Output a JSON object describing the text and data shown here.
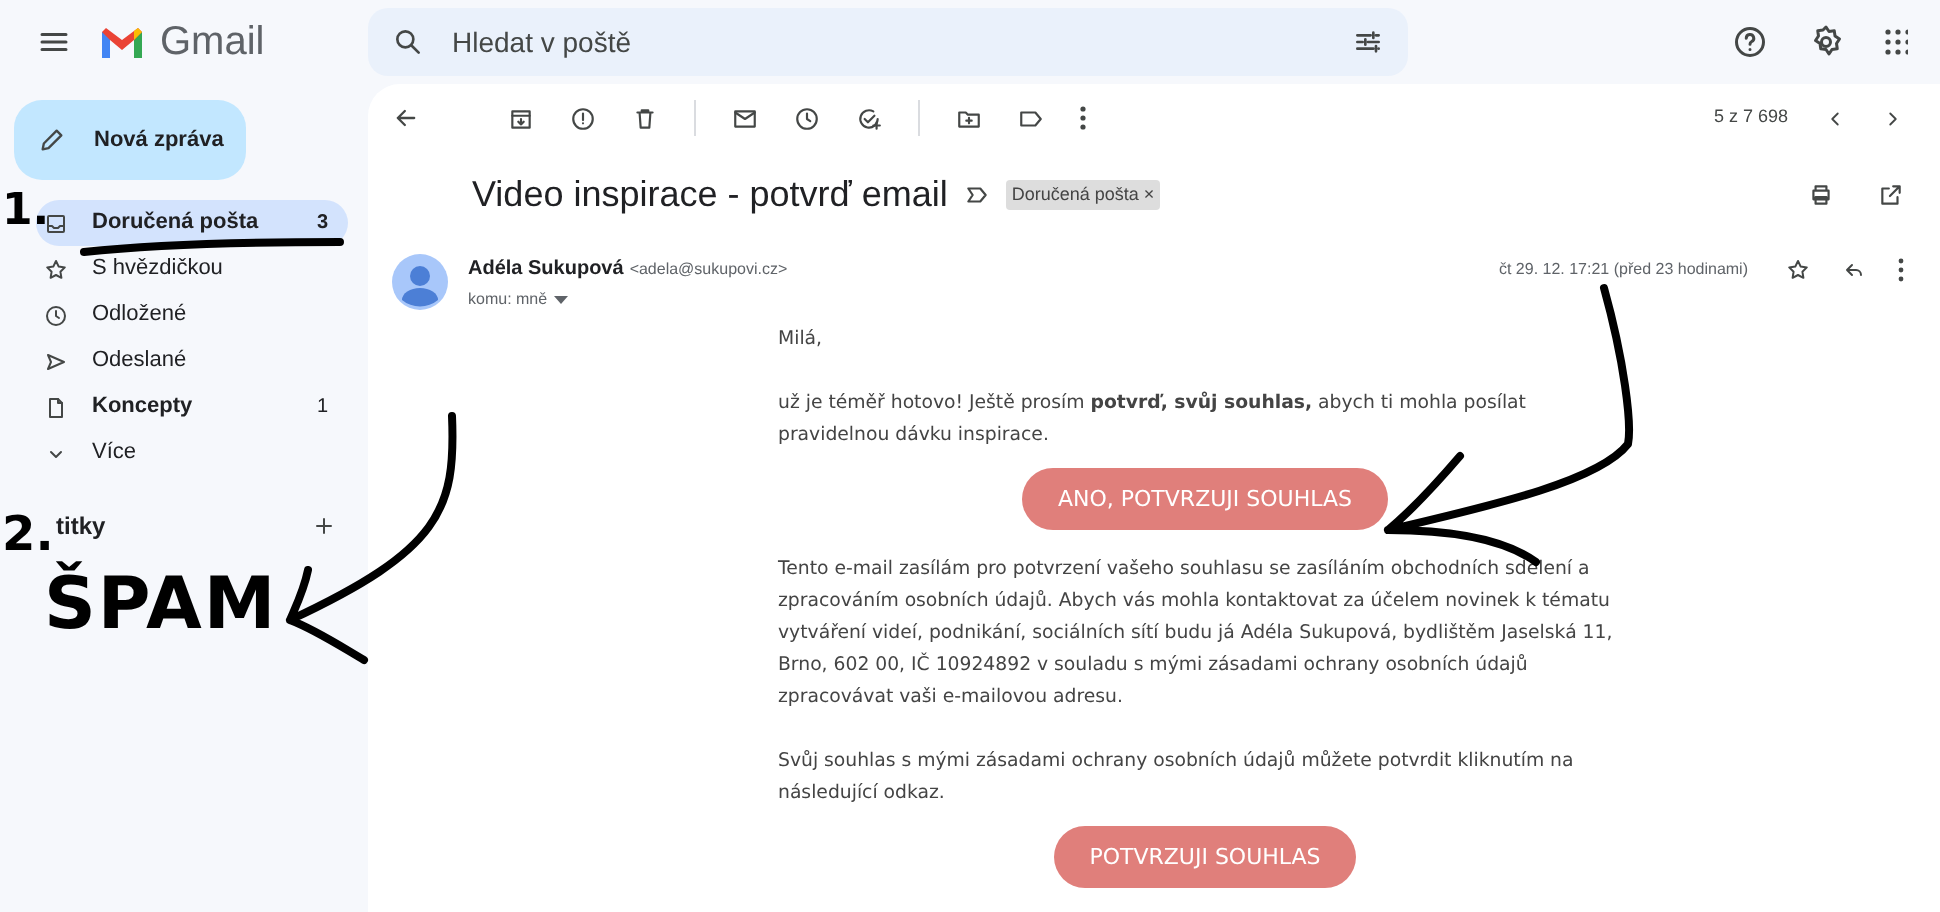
{
  "app": {
    "name": "Gmail"
  },
  "search": {
    "placeholder": "Hledat v poště"
  },
  "compose": {
    "label": "Nová zpráva"
  },
  "sidebar": {
    "items": [
      {
        "label": "Doručená pošta",
        "count": "3",
        "selected": true,
        "bold": true
      },
      {
        "label": "S hvězdičkou",
        "selected": false,
        "bold": false
      },
      {
        "label": "Odložené",
        "selected": false,
        "bold": false
      },
      {
        "label": "Odeslané",
        "selected": false,
        "bold": false
      },
      {
        "label": "Koncepty",
        "count": "1",
        "selected": false,
        "bold": true
      },
      {
        "label": "Více",
        "selected": false,
        "bold": false
      }
    ],
    "labels_heading": "titky"
  },
  "toolbar": {
    "pager": "5 z 7 698"
  },
  "message": {
    "subject": "Video inspirace - potvrď email",
    "tag": "Doručená pošta",
    "tag_close": "×",
    "sender_name": "Adéla Sukupová",
    "sender_email": "<adela@sukupovi.cz>",
    "recipient": "komu: mně",
    "date": "čt 29. 12. 17:21 (před 23 hodinami)",
    "body": [
      {
        "kind": "text",
        "text": "Milá,"
      },
      {
        "kind": "text",
        "text": "už je téměř hotovo! Ještě prosím **potvrď, svůj souhlas,** abych ti mohla posílat pravidelnou dávku inspirace."
      },
      {
        "kind": "button",
        "text": "ANO, POTVRZUJI SOUHLAS"
      },
      {
        "kind": "text",
        "text": "Tento e-mail zasílám pro potvrzení vašeho souhlasu se zasíláním obchodních sdělení a zpracováním osobních údajů. Abych vás mohla kontaktovat za účelem novinek k tématu vytváření videí, podnikání, sociálních sítí budu já Adéla Sukupová, bydlištěm Jaselská 11, Brno, 602 00, IČ 10924892 v souladu s mými zásadami ochrany osobních údajů zpracovávat vaši e-mailovou adresu."
      },
      {
        "kind": "text",
        "text": "Svůj souhlas s mými zásadami ochrany osobních údajů můžete potvrdit kliknutím na následující odkaz."
      },
      {
        "kind": "button",
        "text": "POTVRZUJI SOUHLAS"
      }
    ]
  },
  "annotations": [
    {
      "kind": "number",
      "text": "1."
    },
    {
      "kind": "number",
      "text": "2."
    },
    {
      "kind": "word",
      "text": "ŠPAM"
    }
  ]
}
